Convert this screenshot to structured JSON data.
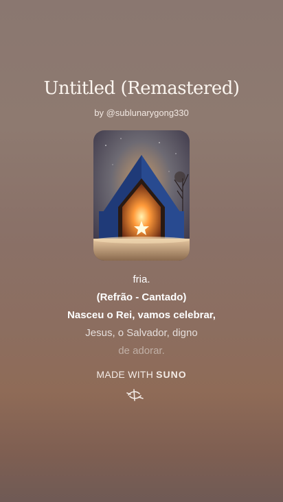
{
  "song": {
    "title": "Untitled (Remastered)",
    "byline": "by @sublunarygong330"
  },
  "lyrics": [
    "fria.",
    "(Refrão - Cantado)",
    "Nasceu o Rei, vamos celebrar,",
    "Jesus, o Salvador, digno",
    "de adorar."
  ],
  "footer": {
    "made_with": "MADE WITH",
    "brand": "SUNO"
  }
}
